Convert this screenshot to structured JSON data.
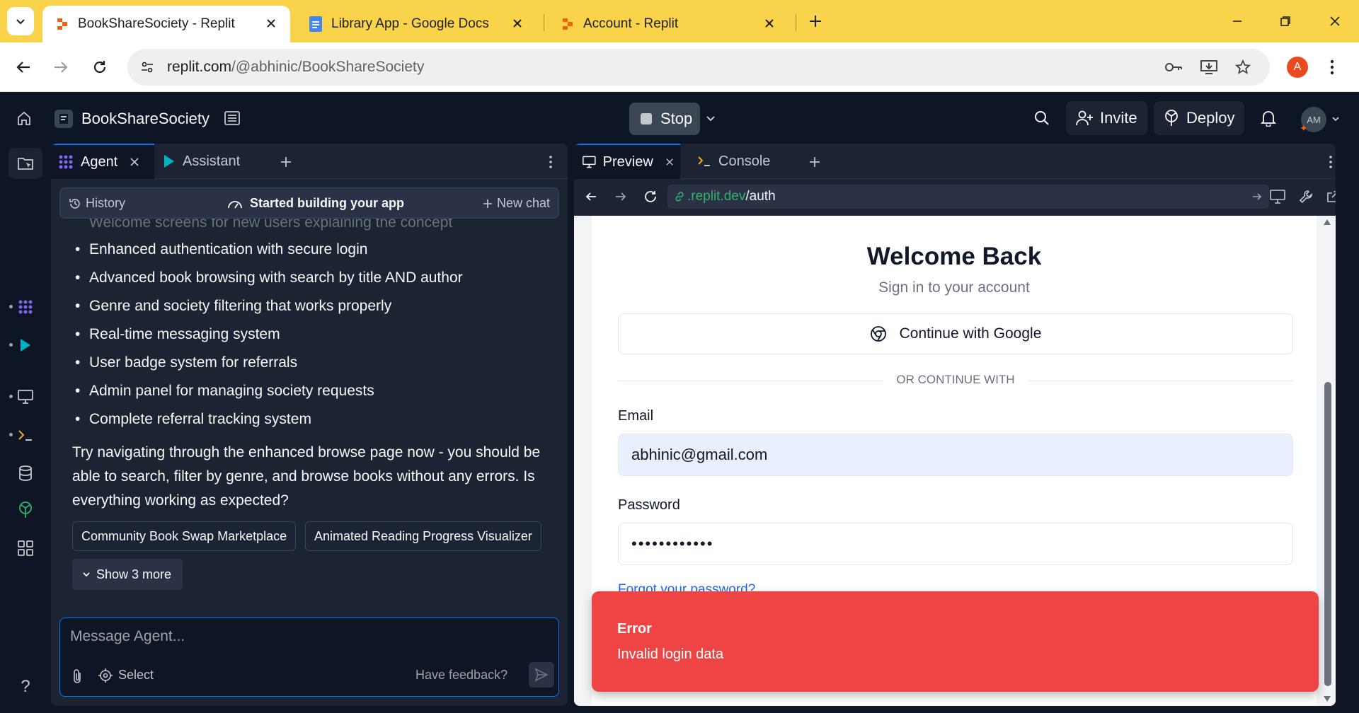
{
  "browser": {
    "tabs": [
      {
        "title": "BookShareSociety - Replit",
        "favicon": "replit-icon",
        "active": true
      },
      {
        "title": "Library App - Google Docs",
        "favicon": "google-docs-icon",
        "active": false
      },
      {
        "title": "Account - Replit",
        "favicon": "replit-icon",
        "active": false
      }
    ],
    "url_host": "replit.com",
    "url_path": "/@abhinic/BookShareSociety",
    "profile_initial": "A",
    "colors": {
      "tabstrip": "#f9d44b",
      "profile": "#ea4a1f"
    }
  },
  "header": {
    "project_name": "BookShareSociety",
    "stop_label": "Stop",
    "invite_label": "Invite",
    "deploy_label": "Deploy",
    "avatar_initials": "AM"
  },
  "agent_panel": {
    "tabs": [
      {
        "label": "Agent",
        "icon": "agent-icon",
        "active": true
      },
      {
        "label": "Assistant",
        "icon": "assistant-icon",
        "active": false
      }
    ],
    "history_label": "History",
    "status_label": "Started building your app",
    "new_chat_label": "New chat",
    "faded_line": "Welcome screens for new users explaining the concept",
    "bullets": [
      "Enhanced authentication with secure login",
      "Advanced book browsing with search by title AND author",
      "Genre and society filtering that works properly",
      "Real-time messaging system",
      "User badge system for referrals",
      "Admin panel for managing society requests",
      "Complete referral tracking system"
    ],
    "paragraph": "Try navigating through the enhanced browse page now - you should be able to search, filter by genre, and browse books without any errors. Is everything working as expected?",
    "suggestions": [
      "Community Book Swap Marketplace",
      "Animated Reading Progress Visualizer"
    ],
    "show_more_label": "Show 3 more",
    "input_placeholder": "Message Agent...",
    "select_label": "Select",
    "feedback_label": "Have feedback?"
  },
  "preview_panel": {
    "tabs": [
      {
        "label": "Preview",
        "icon": "monitor-icon",
        "active": true
      },
      {
        "label": "Console",
        "icon": "terminal-icon",
        "active": false
      }
    ],
    "url_domain": ".replit.dev",
    "url_path": "/auth",
    "page": {
      "title": "Welcome Back",
      "subtitle": "Sign in to your account",
      "google_button": "Continue with Google",
      "divider_text": "OR CONTINUE WITH",
      "email_label": "Email",
      "email_value": "abhinic@gmail.com",
      "password_label": "Password",
      "password_value": "••••••••••••",
      "forgot_link": "Forgot your password?"
    },
    "toast": {
      "title": "Error",
      "message": "Invalid login data",
      "color": "#ef4444"
    }
  },
  "theme": {
    "accent": "#0079f2",
    "bg": "#0e1525",
    "surface": "#1c2333"
  }
}
